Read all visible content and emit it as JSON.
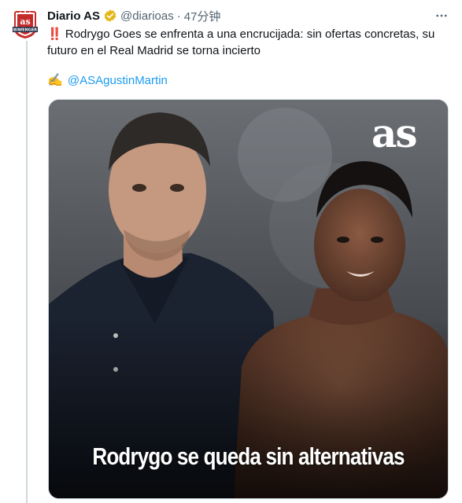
{
  "tweet": {
    "display_name": "Diario AS",
    "handle": "@diarioas",
    "separator": "·",
    "time": "47分钟",
    "emoji_prefix": "‼️",
    "body": "Rodrygo Goes se enfrenta a una encrucijada: sin ofertas concretas, su futuro en el Real Madrid se torna incierto",
    "credit_emoji": "✍️",
    "credit_mention": "@ASAgustinMartin",
    "more_icon": "more-horizontal-icon",
    "verified_icon": "verified-badge-icon",
    "avatar_logo_text": "as",
    "avatar_band_text": "BIWENGER"
  },
  "media": {
    "logo": "as",
    "headline": "Rodrygo se queda sin alternativas"
  },
  "colors": {
    "link": "#1d9bf0",
    "verified_gold": "#e2b719",
    "brand_red": "#c62b2b",
    "secondary_text": "#536471"
  }
}
